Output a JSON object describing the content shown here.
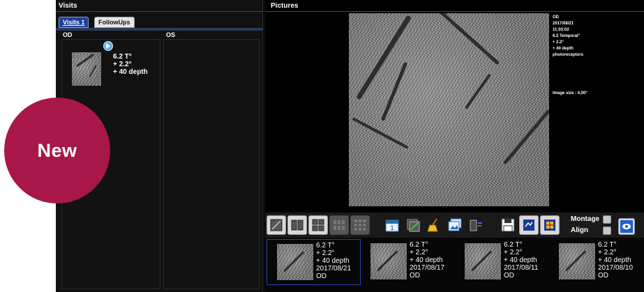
{
  "badge": {
    "label": "New",
    "color": "#a8174a"
  },
  "visits": {
    "title": "Visits",
    "tabs": [
      {
        "label": "Visits 1",
        "active": true
      },
      {
        "label": "FollowUps",
        "active": false
      }
    ],
    "columns": {
      "od": "OD",
      "os": "OS"
    },
    "od_item": {
      "line1": "6.2 T°",
      "line2": "+  2.2°",
      "line3": "+  40 depth"
    }
  },
  "pictures": {
    "title": "Pictures",
    "meta": {
      "eye": "OD",
      "date": "2017/08/21",
      "time": "11:03:02",
      "loc": " 6.2 Temporal°",
      "vert": "+ 2.2°",
      "depth": "+ 40 depth",
      "layer": "photoreceptors",
      "size": "Image size : 4,00°"
    },
    "toolbar": {
      "montage": "Montage",
      "align": "Align"
    },
    "strip": [
      {
        "l1": "6.2 T°",
        "l2": "+ 2.2°",
        "l3": "+ 40 depth",
        "date": "2017/08/21",
        "eye": "OD",
        "selected": true
      },
      {
        "l1": "6.2 T°",
        "l2": "+ 2.2°",
        "l3": "+ 40 depth",
        "date": "2017/08/17",
        "eye": "OD",
        "selected": false
      },
      {
        "l1": "6.2 T°",
        "l2": "+ 2.2°",
        "l3": "+ 40 depth",
        "date": "2017/08/11",
        "eye": "OD",
        "selected": false
      },
      {
        "l1": "6.2 T°",
        "l2": "+ 2.2°",
        "l3": "+ 40 depth",
        "date": "2017/08/10",
        "eye": "OD",
        "selected": false
      }
    ]
  }
}
